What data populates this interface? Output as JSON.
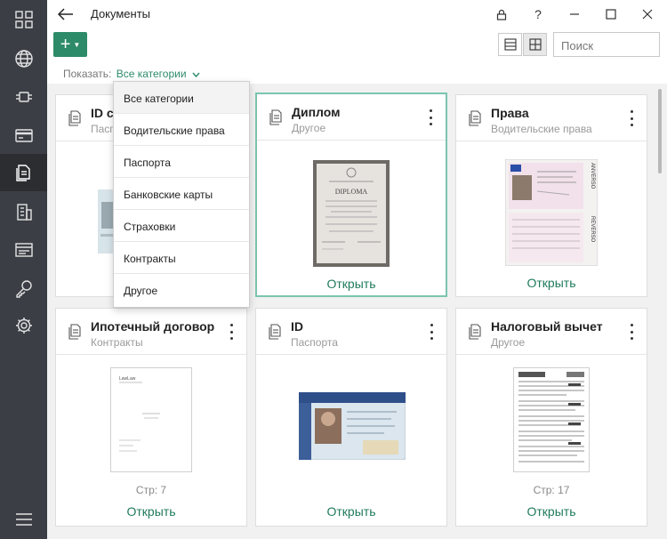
{
  "window": {
    "title": "Документы",
    "controls": {
      "lock": "lock-icon",
      "help": "?",
      "minimize": "minimize-icon",
      "maximize": "maximize-icon",
      "close": "close-icon"
    }
  },
  "sidebar": {
    "items": [
      {
        "icon": "dashboard-icon",
        "active": false
      },
      {
        "icon": "globe-icon",
        "active": false
      },
      {
        "icon": "vpn-icon",
        "active": false
      },
      {
        "icon": "bank-card-icon",
        "active": false
      },
      {
        "icon": "documents-icon",
        "active": true
      },
      {
        "icon": "building-icon",
        "active": false
      },
      {
        "icon": "notes-icon",
        "active": false
      },
      {
        "icon": "key-icon",
        "active": false
      },
      {
        "icon": "settings-icon",
        "active": false
      }
    ],
    "menu_icon": "hamburger-icon"
  },
  "toolbar": {
    "add_label": "+",
    "search_placeholder": "Поиск"
  },
  "filter": {
    "label": "Показать:",
    "value": "Все категории"
  },
  "dropdown": {
    "options": [
      "Все категории",
      "Водительские права",
      "Паспорта",
      "Банковские карты",
      "Страховки",
      "Контракты",
      "Другое"
    ],
    "selected_index": 0
  },
  "cards": [
    {
      "title": "ID card",
      "title_visible": "ID ca",
      "category": "Паспорт",
      "category_visible": "Паспорт",
      "pages": "",
      "open": ""
    },
    {
      "title": "Диплом",
      "category": "Другое",
      "pages": "",
      "open": "Открыть"
    },
    {
      "title": "Права",
      "category": "Водительские права",
      "pages": "",
      "open": "Открыть"
    },
    {
      "title": "Ипотечный договор",
      "category": "Контракты",
      "pages": "Стр: 7",
      "open": "Открыть"
    },
    {
      "title": "ID",
      "category": "Паспорта",
      "pages": "",
      "open": "Открыть"
    },
    {
      "title": "Налоговый вычет",
      "category": "Другое",
      "pages": "Стр: 17",
      "open": "Открыть"
    }
  ],
  "diploma_text": "DIPLOMA",
  "license_text": [
    "ANVERSO",
    "REVERSO"
  ],
  "contract_text": "LawLaw",
  "colors": {
    "accent": "#2e8b6a",
    "rail": "#3b3e44",
    "selected_border": "#7bc4b0"
  }
}
